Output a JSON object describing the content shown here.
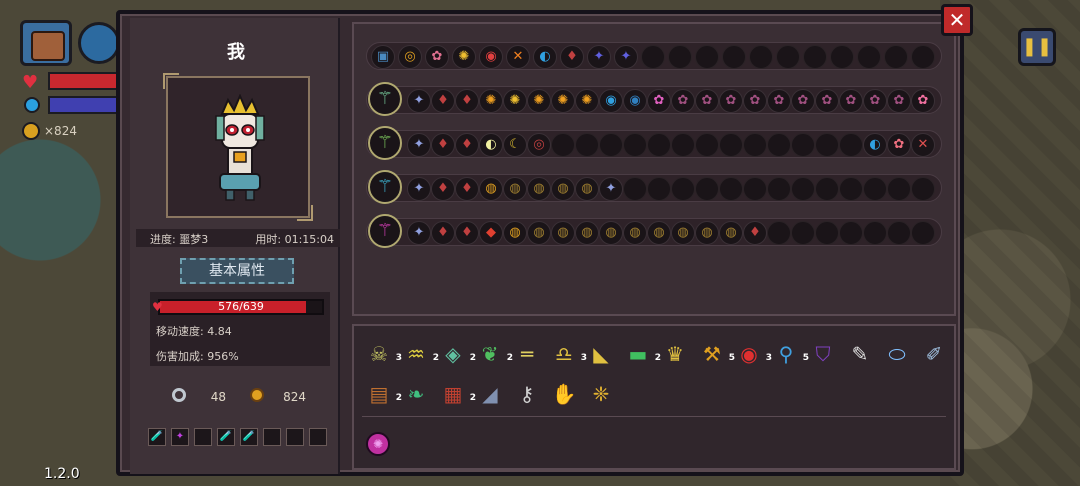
{
  "hud": {
    "coins": "×824",
    "version": "1.2.0"
  },
  "character": {
    "name": "我",
    "progress_label": "进度: 噩梦3",
    "time_label": "用时: 01:15:04",
    "basic_attr_button": "基本属性",
    "hp_text": "576/639",
    "hp_current": 576,
    "hp_max": 639,
    "move_speed": "移动速度: 4.84",
    "damage_bonus": "伤害加成: 956%",
    "keys": "48",
    "gold": "824"
  },
  "inventory_slots": [
    {
      "icon": "potion-icon",
      "glyph": "🧪",
      "color": "#e8a020"
    },
    {
      "icon": "crystal-icon",
      "glyph": "✦",
      "color": "#c040e0"
    },
    {
      "icon": "empty",
      "glyph": "",
      "color": ""
    },
    {
      "icon": "flask-icon",
      "glyph": "🧪",
      "color": "#80c0e0"
    },
    {
      "icon": "potion-icon",
      "glyph": "🧪",
      "color": "#e8a020"
    },
    {
      "icon": "empty",
      "glyph": "",
      "color": ""
    },
    {
      "icon": "empty",
      "glyph": "",
      "color": ""
    },
    {
      "icon": "empty",
      "glyph": "",
      "color": ""
    }
  ],
  "relic_row": {
    "icons": [
      "chest-icon",
      "whirl-icon",
      "blossom-icon",
      "rune-icon",
      "orb-icon",
      "cross-icon",
      "shield-icon",
      "ember-icon",
      "star-icon",
      "star-icon"
    ],
    "glyphs": [
      "▣",
      "◎",
      "✿",
      "✺",
      "◉",
      "✕",
      "◐",
      "♦",
      "✦",
      "✦"
    ],
    "colors": [
      "#4a8ac0",
      "#e0a020",
      "#e07090",
      "#f0c030",
      "#e04040",
      "#f08020",
      "#30a0e0",
      "#c04040",
      "#6060e0",
      "#6060e0"
    ],
    "total_slots": 21
  },
  "wands": [
    {
      "icon": "green-wand-icon",
      "color": "#7ad0a0",
      "spells": [
        "✦",
        "♦",
        "♦",
        "✺",
        "✺",
        "✺",
        "✺",
        "✺",
        "◉",
        "◉",
        "✿",
        "✿",
        "✿",
        "✿",
        "✿",
        "✿",
        "✿",
        "✿",
        "✿",
        "✿",
        "✿",
        "✿"
      ],
      "colors": [
        "#90a0e0",
        "#c04040",
        "#c04040",
        "#f0a020",
        "#f0c030",
        "#f0a020",
        "#f0a020",
        "#f0a020",
        "#30a0e0",
        "#3080c0",
        "#e060c0",
        "#a05080",
        "#a05080",
        "#a05080",
        "#a05080",
        "#a05080",
        "#a05080",
        "#a05080",
        "#a05080",
        "#a05080",
        "#a05080",
        "#f070a0"
      ],
      "total_slots": 22
    },
    {
      "icon": "green-staff-icon",
      "color": "#80d060",
      "spells": [
        "✦",
        "♦",
        "♦",
        "◐",
        "☾",
        "◎",
        "",
        "",
        "",
        "",
        "",
        "",
        "",
        "",
        "",
        "",
        "",
        "",
        "",
        "◐",
        "✿",
        "✕",
        "✿"
      ],
      "colors": [
        "#90a0e0",
        "#c04040",
        "#c04040",
        "#f0f0a0",
        "#e0c030",
        "#c04040",
        "",
        "",
        "",
        "",
        "",
        "",
        "",
        "",
        "",
        "",
        "",
        "",
        "",
        "#30a0e0",
        "#f07080",
        "#e05050",
        "#f07080"
      ],
      "total_slots": 22
    },
    {
      "icon": "blue-sword-icon",
      "color": "#40c0e0",
      "spells": [
        "✦",
        "♦",
        "♦",
        "◍",
        "◍",
        "◍",
        "◍",
        "◍",
        "✦"
      ],
      "colors": [
        "#90a0e0",
        "#c04040",
        "#c04040",
        "#e0a020",
        "#a08030",
        "#a08030",
        "#a08030",
        "#a08030",
        "#90a0e0"
      ],
      "total_slots": 22
    },
    {
      "icon": "pink-wand-icon",
      "color": "#e040c0",
      "spells": [
        "✦",
        "♦",
        "♦",
        "◆",
        "◍",
        "◍",
        "◍",
        "◍",
        "◍",
        "◍",
        "◍",
        "◍",
        "◍",
        "◍",
        "♦"
      ],
      "colors": [
        "#90a0e0",
        "#c04040",
        "#c04040",
        "#e04030",
        "#e0a020",
        "#a08030",
        "#a08030",
        "#a08030",
        "#a08030",
        "#a08030",
        "#a08030",
        "#a08030",
        "#a08030",
        "#a08030",
        "#c04040"
      ],
      "total_slots": 22
    }
  ],
  "perks": [
    {
      "icon": "skull-icon",
      "glyph": "☠",
      "color": "#c0c060",
      "count": "3"
    },
    {
      "icon": "jaws-icon",
      "glyph": "♒",
      "color": "#e0d040",
      "count": "2"
    },
    {
      "icon": "cube-icon",
      "glyph": "◈",
      "color": "#60c0a0",
      "count": "2"
    },
    {
      "icon": "feather-icon",
      "glyph": "❦",
      "color": "#50c060",
      "count": "2"
    },
    {
      "icon": "bone-icon",
      "glyph": "═",
      "color": "#e0d060",
      "count": ""
    },
    {
      "icon": "bell-icon",
      "glyph": "♎",
      "color": "#e0c040",
      "count": "3"
    },
    {
      "icon": "horn-icon",
      "glyph": "◣",
      "color": "#e0c040",
      "count": ""
    },
    {
      "icon": "belt-icon",
      "glyph": "▬",
      "color": "#40c060",
      "count": "2"
    },
    {
      "icon": "crystal-icon",
      "glyph": "♛",
      "color": "#e0c040",
      "count": ""
    },
    {
      "icon": "pickaxe-icon",
      "glyph": "⚒",
      "color": "#e0a020",
      "count": "5"
    },
    {
      "icon": "eye-icon",
      "glyph": "◉",
      "color": "#e03030",
      "count": "3"
    },
    {
      "icon": "magnifier-icon",
      "glyph": "⚲",
      "color": "#40a0e0",
      "count": "5"
    },
    {
      "icon": "shield-icon",
      "glyph": "⛉",
      "color": "#8040c0",
      "count": ""
    },
    {
      "icon": "quill-icon",
      "glyph": "✎",
      "color": "#e0e0e0",
      "count": ""
    },
    {
      "icon": "mirror-icon",
      "glyph": "⬭",
      "color": "#80c0ff",
      "count": ""
    },
    {
      "icon": "syringe-icon",
      "glyph": "✐",
      "color": "#a0c0e0",
      "count": ""
    },
    {
      "icon": "barrel-icon",
      "glyph": "▤",
      "color": "#c07030",
      "count": "2"
    },
    {
      "icon": "leaf-icon",
      "glyph": "❧",
      "color": "#40c080",
      "count": ""
    },
    {
      "icon": "crate-icon",
      "glyph": "▦",
      "color": "#c04030",
      "count": "2"
    },
    {
      "icon": "boot-icon",
      "glyph": "◢",
      "color": "#8090b0",
      "count": ""
    },
    {
      "icon": "key-icon",
      "glyph": "⚷",
      "color": "#d0d0d0",
      "count": ""
    },
    {
      "icon": "glove-icon",
      "glyph": "✋",
      "color": "#a080e0",
      "count": ""
    },
    {
      "icon": "wings-icon",
      "glyph": "❈",
      "color": "#e0b030",
      "count": ""
    }
  ],
  "bottom_perk": {
    "icon": "pink-gem-icon",
    "glyph": "✺",
    "color": "#f0a0f0"
  }
}
